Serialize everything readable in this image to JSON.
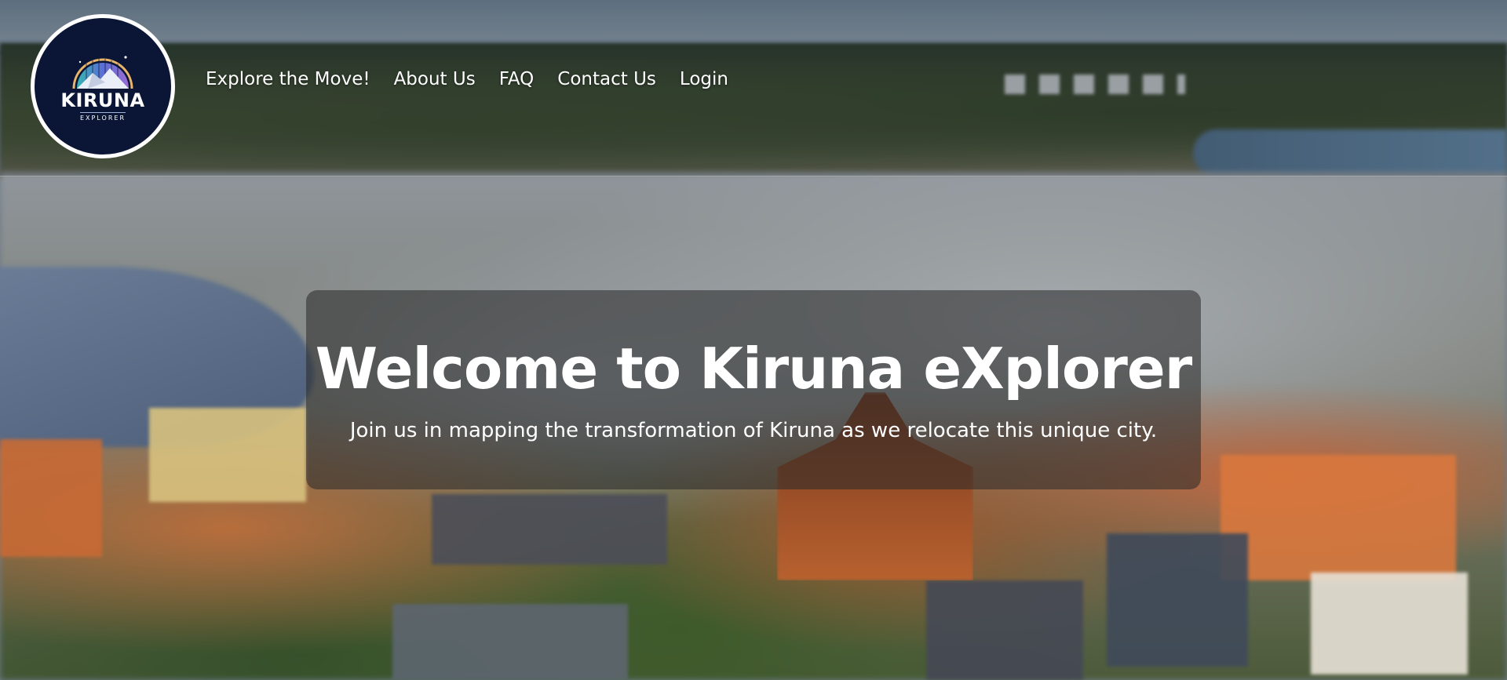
{
  "header": {
    "logo": {
      "title": "KIRUNA",
      "subtitle": "EXPLORER"
    },
    "nav": [
      {
        "label": "Explore the Move!"
      },
      {
        "label": "About Us"
      },
      {
        "label": "FAQ"
      },
      {
        "label": "Contact Us"
      },
      {
        "label": "Login"
      }
    ]
  },
  "hero": {
    "title": "Welcome to Kiruna eXplorer",
    "subtitle": "Join us in mapping the transformation of Kiruna as we relocate this unique city."
  },
  "colors": {
    "logo_background": "#0b1637",
    "overlay": "rgba(40,40,40,0.55)",
    "text": "#ffffff"
  }
}
